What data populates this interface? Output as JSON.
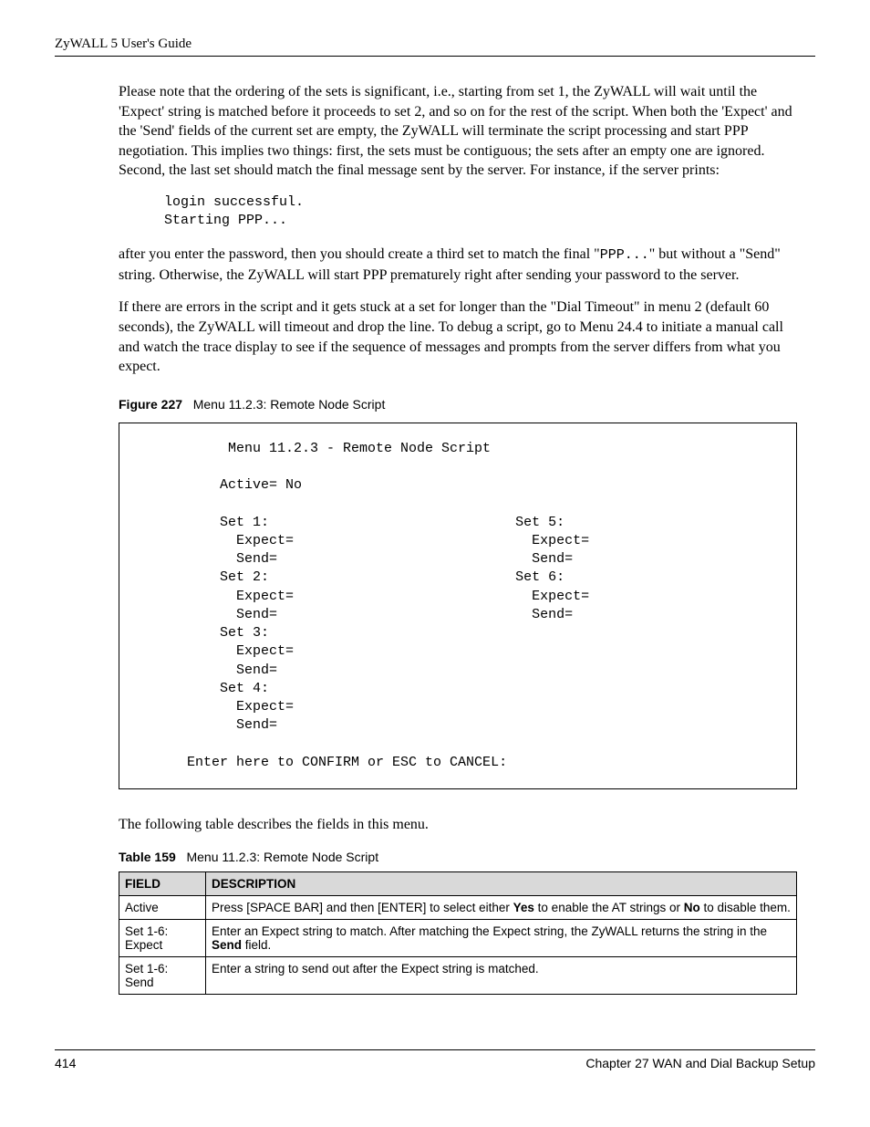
{
  "header": "ZyWALL 5 User's Guide",
  "para1": "Please note that the ordering of the sets is significant, i.e., starting from set 1, the ZyWALL will wait until the 'Expect' string is matched before it proceeds to set 2, and so on for the rest of the script. When both the 'Expect' and the 'Send' fields of the current set are empty, the ZyWALL will terminate the script processing and start PPP negotiation. This implies two things: first, the sets must be contiguous; the sets after an empty one are ignored. Second, the last set should match the final message sent by the server. For instance, if the server prints:",
  "code1": "login successful.\nStarting PPP...",
  "para2_a": "after you enter the password, then you should create a third set to match the final \"",
  "para2_mono": "PPP...",
  "para2_b": "\" but without a \"Send\" string. Otherwise, the ZyWALL will start PPP prematurely right after sending your password to the server.",
  "para3": "If there are errors in the script and it gets stuck at a set for longer than the \"Dial Timeout\" in menu 2 (default 60 seconds), the ZyWALL will timeout and drop the line. To debug a script, go to Menu 24.4 to initiate a manual call and watch the trace display to see if the sequence of messages and prompts from the server differs from what you expect.",
  "figure": {
    "label": "Figure 227",
    "caption": "Menu 11.2.3: Remote Node Script"
  },
  "menu_box": "           Menu 11.2.3 - Remote Node Script\n\n          Active= No\n\n          Set 1:                              Set 5:\n            Expect=                             Expect=\n            Send=                               Send=\n          Set 2:                              Set 6:\n            Expect=                             Expect=\n            Send=                               Send=\n          Set 3:\n            Expect=\n            Send=\n          Set 4:\n            Expect=\n            Send=\n\n      Enter here to CONFIRM or ESC to CANCEL:",
  "para4": "The following table describes the fields in this menu.",
  "table": {
    "label": "Table 159",
    "caption": "Menu 11.2.3: Remote Node Script",
    "head_field": "FIELD",
    "head_desc": "DESCRIPTION",
    "rows": [
      {
        "field": "Active",
        "desc_a": "Press [SPACE BAR] and then [ENTER] to select either ",
        "desc_b1": "Yes",
        "desc_c": " to enable the AT strings or ",
        "desc_b2": "No",
        "desc_d": " to disable them."
      },
      {
        "field": "Set 1-6: Expect",
        "desc_a": "Enter an Expect string to match. After matching the Expect string, the ZyWALL returns the string in the ",
        "desc_b1": "Send",
        "desc_c": " field.",
        "desc_b2": "",
        "desc_d": ""
      },
      {
        "field": "Set 1-6: Send",
        "desc_a": "Enter a string to send out after the Expect string is matched.",
        "desc_b1": "",
        "desc_c": "",
        "desc_b2": "",
        "desc_d": ""
      }
    ]
  },
  "footer": {
    "page": "414",
    "chapter": "Chapter 27 WAN and Dial Backup Setup"
  }
}
